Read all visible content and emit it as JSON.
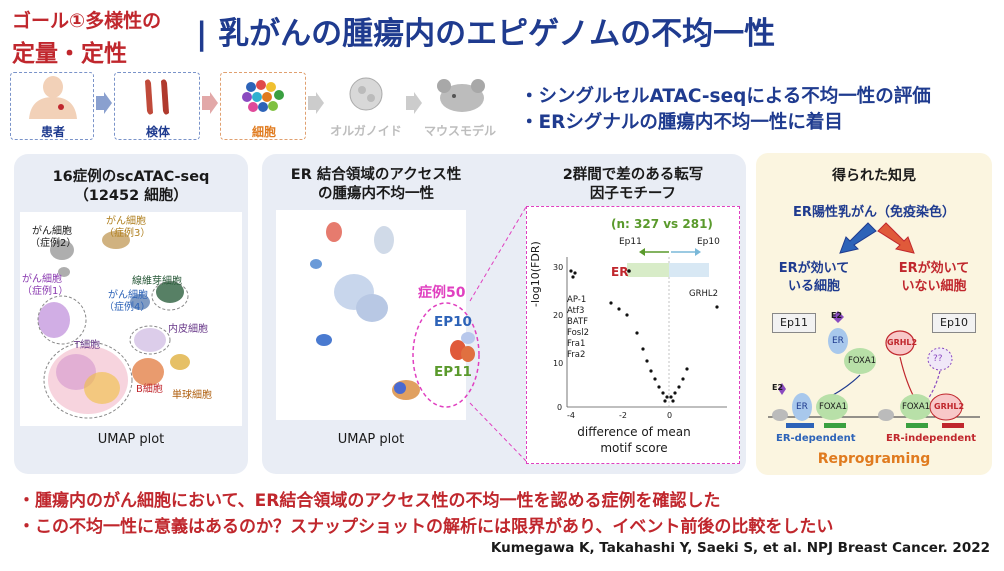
{
  "header": {
    "goal_line1": "ゴール①多様性の",
    "goal_line2": "定量・定性",
    "title": "| 乳がんの腫瘍内のエピゲノムの不均一性"
  },
  "flow": {
    "steps": [
      {
        "label": "患者",
        "color": "#1f3b8f",
        "active": true
      },
      {
        "label": "検体",
        "color": "#1f3b8f",
        "active": true
      },
      {
        "label": "細胞",
        "color": "#e07b1f",
        "active": true
      },
      {
        "label": "オルガノイド",
        "color": "#bdbdbd",
        "active": false
      },
      {
        "label": "マウスモデル",
        "color": "#bdbdbd",
        "active": false
      }
    ]
  },
  "bullets": [
    "・シングルセルATAC-seqによる不均一性の評価",
    "・ERシグナルの腫瘍内不均一性に着目"
  ],
  "panel1": {
    "title_line1": "16症例のscATAC-seq",
    "title_line2": "（12452 細胞）",
    "labels": {
      "gan2_a": "がん細胞",
      "gan2_b": "（症例2）",
      "gan3_a": "がん細胞",
      "gan3_b": "（症例3）",
      "gan1_a": "がん細胞",
      "gan1_b": "（症例1）",
      "fibro": "線維芽細胞",
      "gan4_a": "がん細胞",
      "gan4_b": "（症例4）",
      "endo": "内皮細胞",
      "tcell": "T細胞",
      "bcell": "B細胞",
      "mono": "単球細胞"
    },
    "caption": "UMAP plot"
  },
  "panel2": {
    "title_line1": "ER 結合領域のアクセス性",
    "title_line2": "の腫瘍内不均一性",
    "case_label": "症例50",
    "ep10": "EP10",
    "ep11": "EP11",
    "caption": "UMAP plot"
  },
  "panel3": {
    "title_line1": "2群間で差のある転写",
    "title_line2": "因子モチーフ",
    "n_label": "(n: 327 vs 281)",
    "ep11": "Ep11",
    "ep10": "Ep10",
    "er": "ER",
    "grhl2": "GRHL2",
    "factors": [
      "AP-1",
      "Atf3",
      "BATF",
      "Fosl2",
      "Fra1",
      "Fra2"
    ],
    "ylabel": "-log10(FDR)",
    "xlabel_line1": "difference of mean",
    "xlabel_line2": "motif score",
    "xticks": [
      "-4",
      "-2",
      "0"
    ],
    "yticks": [
      "30",
      "20",
      "10",
      "0"
    ]
  },
  "findings": {
    "title": "得られた知見",
    "er_positive": "ER陽性乳がん（免疫染色）",
    "left_a": "ERが効いて",
    "left_b": "いる細胞",
    "right_a": "ERが効いて",
    "right_b": "いない細胞",
    "ep11": "Ep11",
    "ep10": "Ep10",
    "e2": "E2",
    "er": "ER",
    "foxa1": "FOXA1",
    "grhl2": "GRHL2",
    "unknown": "??",
    "er_dependent": "ER-dependent",
    "er_independent": "ER-independent",
    "reprograming": "Reprograming"
  },
  "bottom": {
    "line1": "・腫瘍内のがん細胞において、ER結合領域のアクセス性の不均一性を認める症例を確認した",
    "line2": "・この不均一性に意義はあるのか？スナップショットの解析には限界があり、イベント前後の比較をしたい"
  },
  "citation": "Kumegawa K, Takahashi Y, Saeki S, et al. NPJ Breast Cancer. 2022",
  "colors": {
    "navy": "#1f3b8f",
    "red": "#c0272d",
    "orange": "#e07b1f",
    "green": "#5a9a2c",
    "blue": "#2d63b8",
    "magenta": "#e040c0"
  }
}
